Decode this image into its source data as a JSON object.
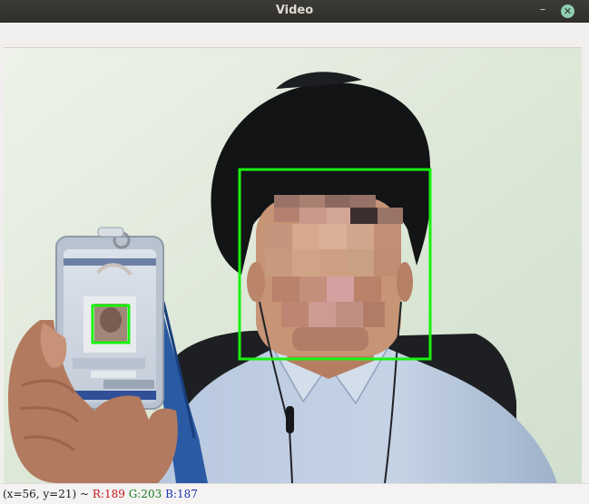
{
  "window": {
    "title": "Video",
    "minimize_glyph": "–",
    "close_glyph": "✕"
  },
  "statusbar": {
    "coords": "(x=56, y=21) ~",
    "r": "R:189",
    "g": "G:203",
    "b": "B:187"
  },
  "icons": {
    "minimize": "minimize-icon",
    "close": "close-icon"
  },
  "colors": {
    "detection_box": "#19f20f",
    "wall": "#dce6d6",
    "shirt": "#b9c9df",
    "hair": "#111315",
    "skin": "#c18c71"
  }
}
